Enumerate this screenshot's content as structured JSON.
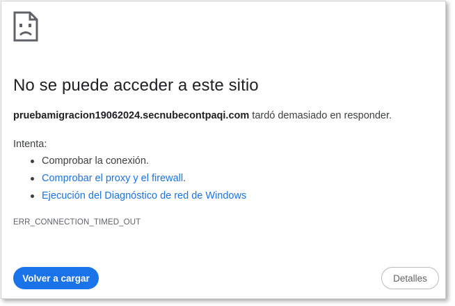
{
  "error_page": {
    "icon": "sad-page-icon",
    "title": "No se puede acceder a este sitio",
    "host": "pruebamigracion19062024.secnubecontpaqi.com",
    "summary_suffix": " tardó demasiado en responder.",
    "try_label": "Intenta:",
    "suggestions": [
      {
        "text": "Comprobar la conexión.",
        "link": false
      },
      {
        "text": "Comprobar el proxy y el firewall",
        "link": true,
        "trailing": "."
      },
      {
        "text": "Ejecución del Diagnóstico de red de Windows",
        "link": true,
        "trailing": ""
      }
    ],
    "error_code": "ERR_CONNECTION_TIMED_OUT",
    "reload_label": "Volver a cargar",
    "details_label": "Detalles"
  },
  "colors": {
    "link": "#1a73e8",
    "primary_button": "#1a73e8",
    "text": "#202124",
    "secondary_text": "#5f6368"
  }
}
